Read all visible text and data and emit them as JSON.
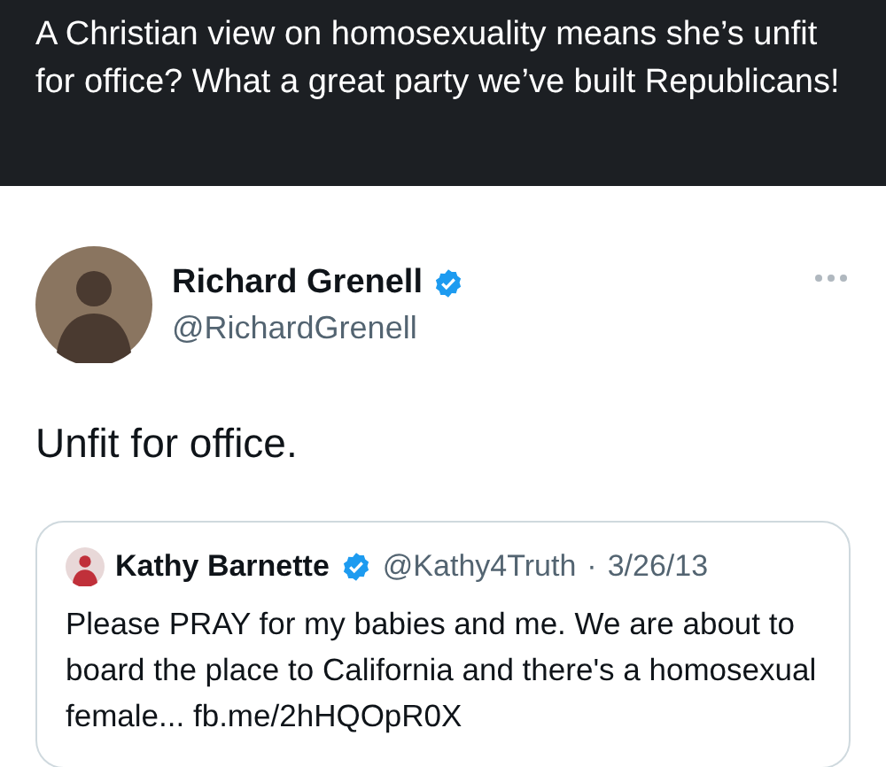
{
  "comment_text": "A Christian view on homosexuality means she’s unfit for office? What a great party we’ve built Republicans!",
  "tweet": {
    "name": "Richard Grenell",
    "verified": true,
    "handle": "@RichardGrenell",
    "text": "Unfit for office.",
    "quoted": {
      "name": "Kathy Barnette",
      "verified": true,
      "handle": "@Kathy4Truth",
      "separator": "·",
      "date": "3/26/13",
      "text": "Please PRAY for my babies and me. We are about to board the place to California and there's a homosexual female... fb.me/2hHQOpR0X"
    }
  }
}
